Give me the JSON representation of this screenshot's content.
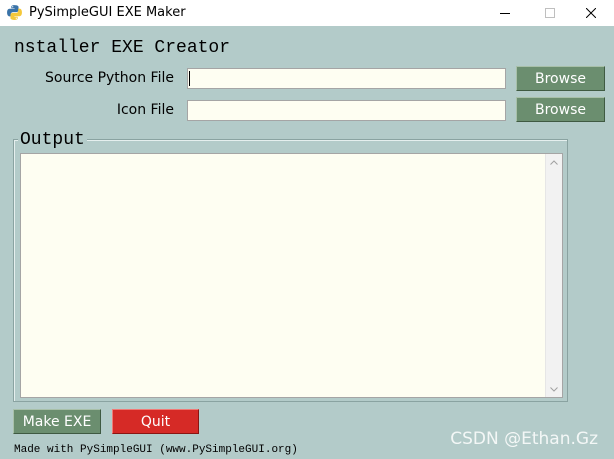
{
  "window": {
    "title": "PySimpleGUI EXE Maker",
    "icon": "python-logo-icon"
  },
  "header": {
    "title": "nstaller EXE Creator"
  },
  "form": {
    "source_label": "Source Python File",
    "source_value": "",
    "icon_label": "Icon File",
    "icon_value": "",
    "browse_label": "Browse"
  },
  "output": {
    "title": "Output",
    "content": ""
  },
  "actions": {
    "make_label": "Make EXE",
    "quit_label": "Quit"
  },
  "footer": {
    "text": "Made with PySimpleGUI (www.PySimpleGUI.org)"
  },
  "watermark": {
    "text": "CSDN @Ethan.Gz"
  },
  "colors": {
    "background": "#b3cbc9",
    "button_green": "#6b8e6f",
    "button_red": "#d62a26",
    "input_bg": "#fefef2"
  }
}
